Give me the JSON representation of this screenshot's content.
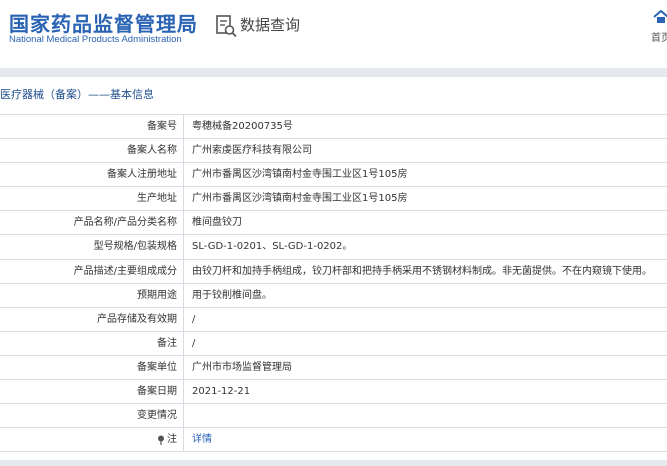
{
  "header": {
    "logo_cn": "国家药品监督管理局",
    "logo_en": "National Medical Products Administration",
    "query_label": "数据查询",
    "home_label": "首页"
  },
  "section": {
    "title": "医疗器械（备案）——基本信息"
  },
  "rows": [
    {
      "label": "备案号",
      "value": "粤穗械备20200735号"
    },
    {
      "label": "备案人名称",
      "value": "广州索虔医疗科技有限公司"
    },
    {
      "label": "备案人注册地址",
      "value": "广州市番禺区沙湾镇南村金寺围工业区1号105房"
    },
    {
      "label": "生产地址",
      "value": "广州市番禺区沙湾镇南村金寺围工业区1号105房"
    },
    {
      "label": "产品名称/产品分类名称",
      "value": "椎间盘铰刀"
    },
    {
      "label": "型号规格/包装规格",
      "value": "SL-GD-1-0201、SL-GD-1-0202。"
    },
    {
      "label": "产品描述/主要组成成分",
      "value": "由铰刀杆和加持手柄组成，铰刀杆部和把持手柄采用不锈钢材料制成。非无菌提供。不在内窥镜下使用。"
    },
    {
      "label": "预期用途",
      "value": "用于铰削椎间盘。"
    },
    {
      "label": "产品存储及有效期",
      "value": "/"
    },
    {
      "label": "备注",
      "value": "/"
    },
    {
      "label": "备案单位",
      "value": "广州市市场监督管理局"
    },
    {
      "label": "备案日期",
      "value": "2021-12-21"
    },
    {
      "label": "变更情况",
      "value": ""
    }
  ],
  "note": {
    "label": "注",
    "link": "详情"
  },
  "colors": {
    "brand_blue": "#2a63b4",
    "border": "#d8dde3",
    "bar": "#e5e9ee"
  }
}
